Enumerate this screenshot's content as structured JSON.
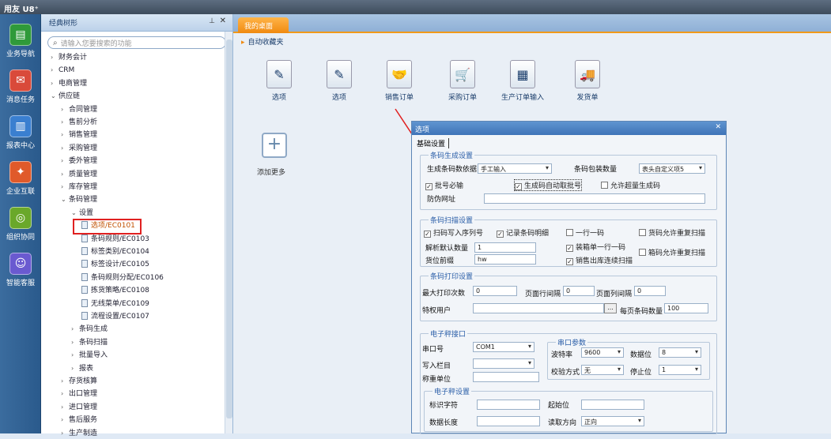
{
  "app": {
    "title": "用友 U8⁺"
  },
  "leftnav": [
    {
      "label": "业务导航",
      "icon": "business-nav-icon"
    },
    {
      "label": "消息任务",
      "icon": "message-task-icon"
    },
    {
      "label": "报表中心",
      "icon": "report-center-icon"
    },
    {
      "label": "企业互联",
      "icon": "enterprise-connect-icon"
    },
    {
      "label": "组织协同",
      "icon": "org-collab-icon"
    },
    {
      "label": "智能客服",
      "icon": "smart-service-icon"
    }
  ],
  "sidebar": {
    "title": "经典树形",
    "search_placeholder": "请输入您要搜索的功能",
    "tree": [
      "财务会计",
      "CRM",
      "电商管理",
      "供应链",
      "合同管理",
      "售前分析",
      "销售管理",
      "采购管理",
      "委外管理",
      "质量管理",
      "库存管理",
      "条码管理",
      "设置",
      "选项/EC0101",
      "条码规则/EC0103",
      "标签类别/EC0104",
      "标签设计/EC0105",
      "条码规则分配/EC0106",
      "拣货策略/EC0108",
      "无线菜单/EC0109",
      "流程设置/EC0107",
      "条码生成",
      "条码扫描",
      "批量导入",
      "报表",
      "存货核算",
      "出口管理",
      "进口管理",
      "售后服务",
      "生产制造"
    ]
  },
  "main": {
    "tab": "我的桌面",
    "favorites": "自动收藏夹",
    "apps": [
      "选项",
      "选项",
      "销售订单",
      "采购订单",
      "生产订单输入",
      "发货单"
    ],
    "add_more": "添加更多"
  },
  "dialog": {
    "title": "选项",
    "tab": "基础设置",
    "g1": {
      "title": "条码生成设置",
      "gen_basis_label": "生成条码数依据",
      "gen_basis": "手工输入",
      "pack_qty_label": "条码包装数量",
      "pack_qty": "表头自定义项5",
      "batch_required": "批号必输",
      "auto_batch": "生成码自动取批号",
      "allow_exceed": "允许超量生成码",
      "anti_fake": "防伪网址"
    },
    "g2": {
      "title": "条码扫描设置",
      "scan_serial": "扫码写入序列号",
      "record_detail": "记录条码明细",
      "one_line_one": "一行一码",
      "allow_repeat": "货码允许重复扫描",
      "default_qty_label": "解析默认数量",
      "default_qty": "1",
      "loading_one": "装箱单一行一码",
      "box_repeat": "箱码允许重复扫描",
      "prefix_label": "货位前缀",
      "prefix": "hw",
      "continuous": "销售出库连续扫描"
    },
    "g3": {
      "title": "条码打印设置",
      "max_print_label": "最大打印次数",
      "max_print": "0",
      "row_gap_label": "页面行间隔",
      "row_gap": "0",
      "col_gap_label": "页面列间隔",
      "col_gap": "0",
      "special_user_label": "特权用户",
      "browse": "...",
      "per_page_label": "每页条码数量",
      "per_page": "100"
    },
    "g4": {
      "title": "电子秤接口",
      "port_label": "串口号",
      "port": "COM1",
      "col_label": "写入栏目",
      "unit_label": "称重单位",
      "serial_title": "串口参数",
      "baud_label": "波特率",
      "baud": "9600",
      "data_bits_label": "数据位",
      "data_bits": "8",
      "parity_label": "校验方式",
      "parity": "无",
      "stop_label": "停止位",
      "stop": "1",
      "scale": {
        "title": "电子秤设置",
        "id_char_label": "标识字符",
        "start_label": "起始位",
        "len_label": "数据长度",
        "dir_label": "读取方向",
        "dir": "正向"
      }
    }
  }
}
